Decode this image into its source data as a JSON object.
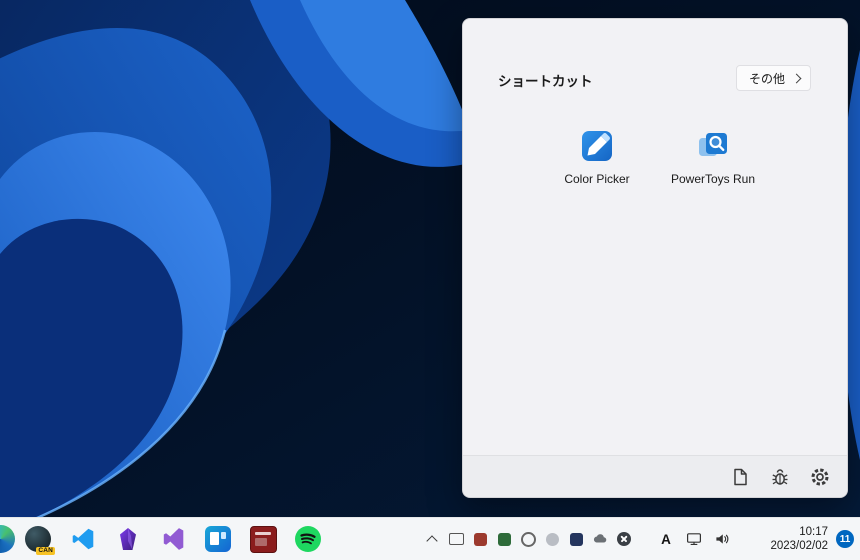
{
  "panel": {
    "title": "ショートカット",
    "more_button": {
      "label": "その他"
    },
    "shortcuts": [
      {
        "name": "color-picker",
        "label": "Color Picker"
      },
      {
        "name": "powertoys-run",
        "label": "PowerToys Run"
      }
    ],
    "footer_icons": [
      "document",
      "bug-report",
      "settings-gear"
    ]
  },
  "taskbar": {
    "apps": [
      {
        "name": "browser"
      },
      {
        "name": "app-with-can-badge",
        "badge": "CAN"
      },
      {
        "name": "vscode"
      },
      {
        "name": "obsidian"
      },
      {
        "name": "visual-studio"
      },
      {
        "name": "powertoys"
      },
      {
        "name": "hardware-monitor"
      },
      {
        "name": "spotify"
      }
    ],
    "tray_icons": [
      "hidden-icons-chevron",
      "tray-app-1",
      "tray-app-2",
      "tray-app-3",
      "tray-app-4",
      "tray-app-5",
      "tray-app-6",
      "onedrive-cloud",
      "blocked-app"
    ],
    "ime_indicator": "A",
    "clock": {
      "time": "10:17",
      "date": "2023/02/02"
    },
    "notification_badge": "11"
  },
  "colors": {
    "accent_blue": "#0067c0",
    "taskbar_bg": "#f4f6f8",
    "panel_bg": "#f2f2f5",
    "wallpaper_blue": "#1f6ad0"
  }
}
